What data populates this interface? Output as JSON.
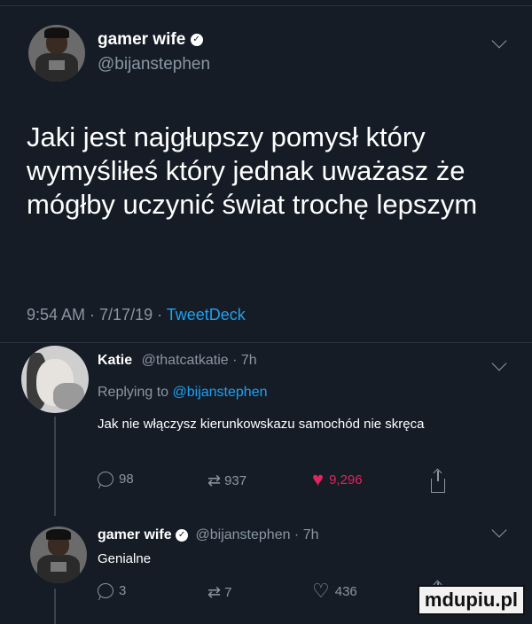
{
  "main_tweet": {
    "display_name": "gamer wife",
    "handle": "@bijanstephen",
    "text": "Jaki jest najgłupszy pomysł który wymyśliłeś który jednak uważasz że mógłby uczynić świat trochę lepszym",
    "timestamp": "9:54 AM · 7/17/19 · ",
    "client": "TweetDeck"
  },
  "reply_katie": {
    "display_name": "Katie",
    "handle_time": "@thatcatkatie · 7h",
    "replying_prefix": "Replying to ",
    "replying_to": "@bijanstephen",
    "text": "Jak nie włączysz kierunkowskazu samochód nie skręca",
    "replies": "98",
    "retweets": "937",
    "likes": "9,296"
  },
  "reply_gamer": {
    "display_name": "gamer wife",
    "handle_time": "@bijanstephen · 7h",
    "text": "Genialne",
    "replies": "3",
    "retweets": "7",
    "likes": "436"
  },
  "watermark": "mdupiu.pl",
  "colors": {
    "background": "#151c26",
    "accent": "#1da1f2",
    "like_active": "#e0245e",
    "muted": "#8a96a3"
  }
}
